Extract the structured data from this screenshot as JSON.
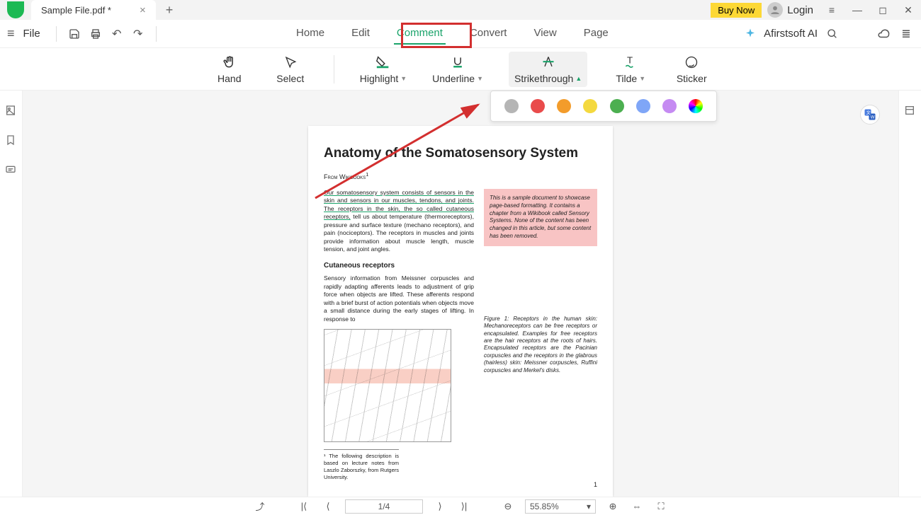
{
  "titlebar": {
    "tab_name": "Sample File.pdf *",
    "buy": "Buy Now",
    "login": "Login"
  },
  "menubar": {
    "file": "File",
    "items": [
      "Home",
      "Edit",
      "Comment",
      "Convert",
      "View",
      "Page"
    ],
    "active_index": 2,
    "ai": "Afirstsoft AI"
  },
  "toolbar": {
    "hand": "Hand",
    "select": "Select",
    "highlight": "Highlight",
    "underline": "Underline",
    "strike": "Strikethrough",
    "tilde": "Tilde",
    "sticker": "Sticker"
  },
  "colors": [
    "#b5b5b5",
    "#e94b4b",
    "#f39c2b",
    "#f4d93f",
    "#4caf50",
    "#7fa6f7",
    "#c58bf2",
    "rainbow"
  ],
  "document": {
    "title": "Anatomy of the Somatosensory System",
    "from": "From Wikibooks",
    "para1_underlined": "Our somatosensory system consists of sensors in the skin and sensors in our muscles, tendons, and joints. The receptors in the skin, the so called cutaneous receptors,",
    "para1_rest": " tell us about temperature (thermoreceptors), pressure and surface texture (mechano receptors), and pain (nociceptors). The receptors in muscles and joints provide information about muscle length, muscle tension, and joint angles.",
    "pinkbox": "This is a sample document to showcase page-based formatting. It contains a chapter from a Wikibook called Sensory Systems. None of the content has been changed in this article, but some content has been removed.",
    "subhead": "Cutaneous receptors",
    "para2": "Sensory information from Meissner corpuscles and rapidly adapting afferents leads to adjustment of grip force when objects are lifted. These afferents respond with a brief burst of action potentials when objects move a small distance during the early stages of lifting. In response to",
    "figure_caption": "Figure 1: Receptors in the human skin: Mechanoreceptors can be free receptors or encapsulated. Examples for free receptors are the hair receptors at the roots of hairs. Encapsulated receptors are the Pacinian corpuscles and the receptors in the glabrous (hairless) skin: Meissner corpuscles, Ruffini corpuscles and Merkel's disks.",
    "footnote": "¹ The following description is based on lecture notes from Laszlo Zaborszky, from Rutgers University.",
    "page_number": "1"
  },
  "statusbar": {
    "page": "1/4",
    "zoom": "55.85%"
  }
}
